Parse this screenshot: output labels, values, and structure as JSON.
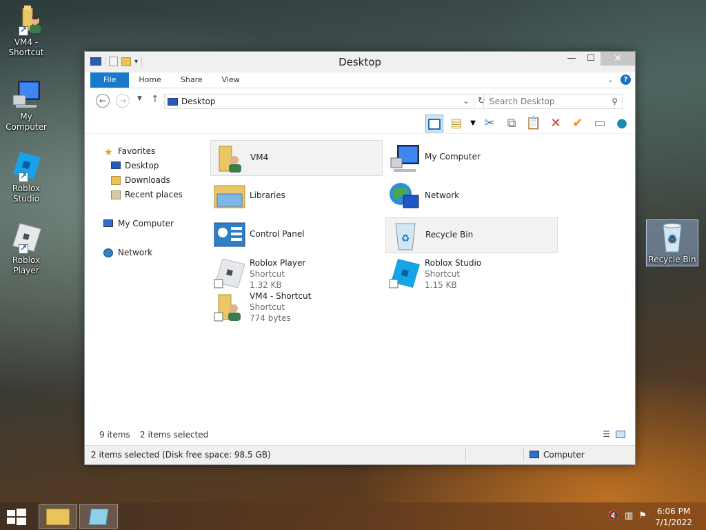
{
  "desktop_icons": [
    {
      "label": "VM4 - Shortcut"
    },
    {
      "label": "My Computer"
    },
    {
      "label": "Roblox Studio"
    },
    {
      "label": "Roblox Player"
    },
    {
      "label": "Recycle Bin"
    }
  ],
  "window": {
    "title": "Desktop",
    "minimize_glyph": "—",
    "maximize_glyph": "☐",
    "close_glyph": "✕",
    "ribbon_tabs": [
      "File",
      "Home",
      "Share",
      "View"
    ],
    "help_glyph": "?",
    "address": "Desktop",
    "search_placeholder": "Search Desktop"
  },
  "nav_pane": {
    "favorites": "Favorites",
    "desktop": "Desktop",
    "downloads": "Downloads",
    "recent_places": "Recent places",
    "my_computer": "My Computer",
    "network": "Network"
  },
  "items": [
    {
      "name": "VM4"
    },
    {
      "name": "My Computer"
    },
    {
      "name": "Libraries"
    },
    {
      "name": "Network"
    },
    {
      "name": "Control Panel"
    },
    {
      "name": "Recycle Bin"
    },
    {
      "name": "Roblox Player",
      "type": "Shortcut",
      "size": "1.32 KB"
    },
    {
      "name": "Roblox Studio",
      "type": "Shortcut",
      "size": "1.15 KB"
    },
    {
      "name": "VM4 - Shortcut",
      "type": "Shortcut",
      "size": "774 bytes"
    }
  ],
  "status": {
    "item_count": "9 items",
    "selected": "2 items selected",
    "bottom_left": "2 items selected (Disk free space: 98.5 GB)",
    "bottom_right": "Computer"
  },
  "taskbar": {
    "time": "6:06 PM",
    "date": "7/1/2022"
  },
  "colors": {
    "file_tab": "#1979ca",
    "selection": "#cde6f7"
  }
}
